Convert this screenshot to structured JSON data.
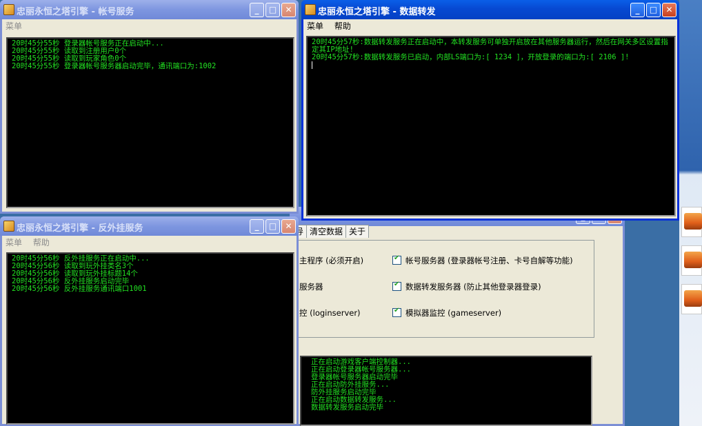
{
  "desktop": {
    "icons": [
      "desktop-icon-1",
      "desktop-icon-2",
      "desktop-icon-3"
    ]
  },
  "window_account": {
    "title": "忠丽永恒之塔引擎 - 帐号服务",
    "menu": [
      "菜单"
    ],
    "log": [
      "20时45分55秒 登录器帐号服务正在启动中...",
      "20时45分55秒 读取到注册用户0个",
      "20时45分55秒 读取到玩家角色0个",
      "20时45分55秒 登录器帐号服务器启动完毕，通讯端口为:1002"
    ]
  },
  "window_anticheat": {
    "title": "忠丽永恒之塔引擎 - 反外挂服务",
    "menu": [
      "菜单",
      "帮助"
    ],
    "log": [
      "20时45分56秒 反外挂服务正在启动中...",
      "20时45分56秒 读取到玩外挂类名3个",
      "20时45分56秒 读取到玩外挂标题14个",
      "20时45分56秒 反外挂服务启动完毕",
      "20时45分56秒 反外挂服务通讯端口1001"
    ]
  },
  "window_forward": {
    "title": "忠丽永恒之塔引擎 - 数据转发",
    "menu": [
      "菜单",
      "帮助"
    ],
    "log": [
      "20时45分57秒:数据转发服务正在启动中，本转发服务可单独开启放在其他服务器运行，然后在网关多区设置指定其IP地址!",
      "20时45分57秒:数据转发服务已启动，内部LS端口为:[ 1234 ]，开放登录的端口为:[ 2106 ]!"
    ]
  },
  "window_main": {
    "tabs": [
      "导",
      "清空数据",
      "关于"
    ],
    "options_left": [
      "主程序 (必须开启)",
      "服务器",
      "控 (loginserver)"
    ],
    "options_right": [
      "帐号服务器 (登录器帐号注册、卡号自解等功能)",
      "数据转发服务器 (防止其他登录器登录)",
      "模拟器监控 (gameserver)"
    ],
    "log": [
      "正在启动游戏客户端控制器...",
      "正在启动登录器帐号服务器...",
      "登录器帐号服务器启动完毕",
      "正在启动防外挂服务...",
      "防外挂服务启动完毕",
      "正在启动数据转发服务...",
      "数据转发服务启动完毕"
    ]
  }
}
